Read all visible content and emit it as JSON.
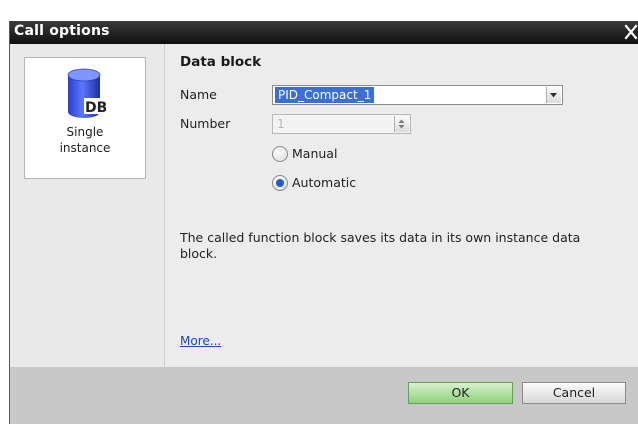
{
  "dialog": {
    "title": "Call options",
    "close_icon": "close-icon"
  },
  "left_panel": {
    "card": {
      "icon": "database-icon",
      "icon_text": "DB",
      "label_line1": "Single",
      "label_line2": "instance"
    }
  },
  "main": {
    "section_title": "Data block",
    "name_label": "Name",
    "name_value": "PID_Compact_1",
    "number_label": "Number",
    "number_value": "1",
    "radio_manual": "Manual",
    "radio_automatic": "Automatic",
    "selected_option": "Automatic",
    "description": "The called function block saves its data in its own instance data block.",
    "more_link": "More..."
  },
  "buttons": {
    "ok": "OK",
    "cancel": "Cancel"
  },
  "colors": {
    "titlebar": "#1a1a1a",
    "selection": "#3a6fd8",
    "ok_button": "#8ed27a",
    "link": "#1d43c8"
  }
}
